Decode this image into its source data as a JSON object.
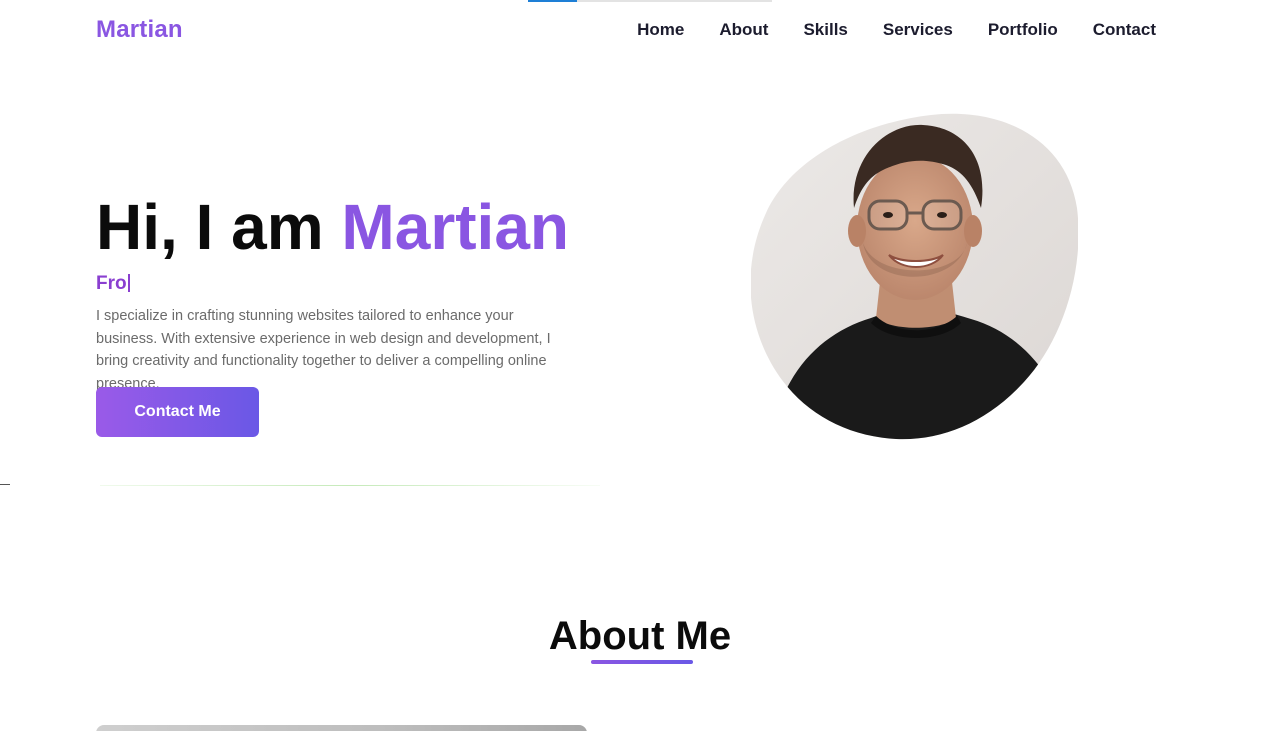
{
  "brand": {
    "name": "Martian",
    "accent_color": "#8a56e2",
    "gradient_end": "#6a58e6"
  },
  "progress": {
    "value": 0.2
  },
  "nav": {
    "items": [
      {
        "label": "Home"
      },
      {
        "label": "About"
      },
      {
        "label": "Skills"
      },
      {
        "label": "Services"
      },
      {
        "label": "Portfolio"
      },
      {
        "label": "Contact"
      }
    ]
  },
  "hero": {
    "greeting": "Hi, I am",
    "name": "Martian",
    "typed_text": "Fro",
    "description": "I specialize in crafting stunning websites tailored to enhance your business. With extensive experience in web design and development, I bring creativity and functionality together to deliver a compelling online presence.",
    "cta_label": "Contact Me",
    "portrait_icon": "person-portrait-icon"
  },
  "about": {
    "title": "About Me"
  }
}
